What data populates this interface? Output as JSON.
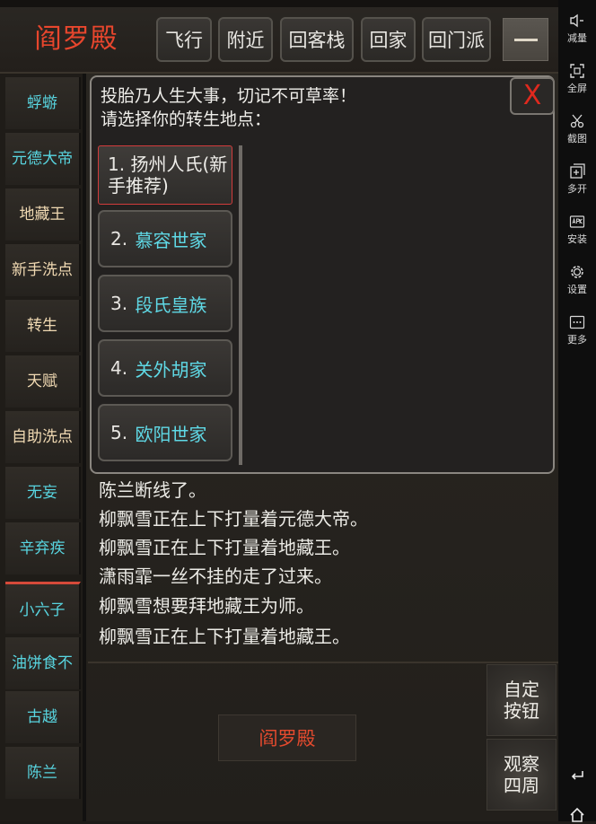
{
  "header": {
    "title": "阎罗殿",
    "buttons": [
      "飞行",
      "附近",
      "回客栈",
      "回家",
      "回门派"
    ]
  },
  "sidebar": {
    "items": [
      {
        "label": "蜉蝣"
      },
      {
        "label": "元德大帝"
      },
      {
        "label": "地藏王"
      },
      {
        "label": "新手洗点"
      },
      {
        "label": "转生"
      },
      {
        "label": "天赋"
      },
      {
        "label": "自助洗点"
      },
      {
        "label": "无妄"
      },
      {
        "label": "辛弃疾"
      },
      {
        "label": "小六子"
      },
      {
        "label": "油饼食不"
      },
      {
        "label": "古越"
      },
      {
        "label": "陈兰"
      }
    ]
  },
  "modal": {
    "prompt_line1": "投胎乃人生大事，切记不可草率！",
    "prompt_line2": "请选择你的转生地点：",
    "close_label": "X",
    "options": [
      {
        "num": "1.",
        "name": "扬州人氏(新手推荐)"
      },
      {
        "num": "2.",
        "name": "慕容世家"
      },
      {
        "num": "3.",
        "name": "段氏皇族"
      },
      {
        "num": "4.",
        "name": "关外胡家"
      },
      {
        "num": "5.",
        "name": "欧阳世家"
      }
    ]
  },
  "chat": {
    "lines": [
      "陈兰断线了。",
      "柳飘雪正在上下打量着元德大帝。",
      "柳飘雪正在上下打量着地藏王。",
      "潇雨霏一丝不挂的走了过来。",
      "柳飘雪想要拜地藏王为师。",
      "柳飘雪正在上下打量着地藏王。"
    ]
  },
  "bottom": {
    "location": "阎罗殿",
    "custom_button": "自定按钮",
    "look_button": "观察四周"
  },
  "toolbar": {
    "items": [
      {
        "label": "减量",
        "icon": "volume-down-icon"
      },
      {
        "label": "全屏",
        "icon": "fullscreen-icon"
      },
      {
        "label": "截图",
        "icon": "scissors-icon"
      },
      {
        "label": "多开",
        "icon": "multi-open-icon"
      },
      {
        "label": "安装",
        "icon": "apk-install-icon"
      },
      {
        "label": "设置",
        "icon": "gear-icon"
      },
      {
        "label": "更多",
        "icon": "more-icon"
      }
    ]
  },
  "colors": {
    "title_red": "#e8462d",
    "cyan": "#5fd9e6",
    "tan": "#f0d9b2",
    "background": "#2b2823"
  }
}
